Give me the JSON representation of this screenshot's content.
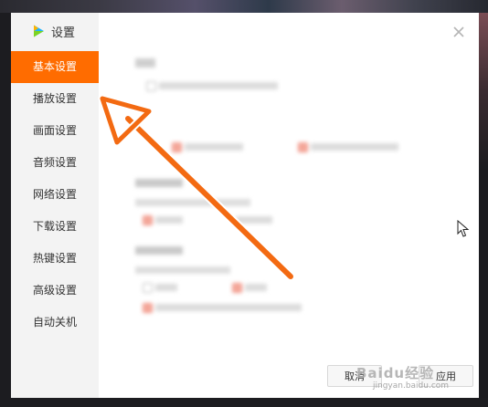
{
  "app": {
    "title": "设置",
    "accent_color": "#ff6c00"
  },
  "sidebar": {
    "items": [
      {
        "label": "基本设置",
        "active": true
      },
      {
        "label": "播放设置",
        "active": false
      },
      {
        "label": "画面设置",
        "active": false
      },
      {
        "label": "音频设置",
        "active": false
      },
      {
        "label": "网络设置",
        "active": false
      },
      {
        "label": "下载设置",
        "active": false
      },
      {
        "label": "热键设置",
        "active": false
      },
      {
        "label": "高级设置",
        "active": false
      },
      {
        "label": "自动关机",
        "active": false
      }
    ]
  },
  "footer": {
    "cancel_label": "取消",
    "apply_label": "应用"
  },
  "watermark": {
    "text": "Baidu经验",
    "url": "jingyan.baidu.com"
  },
  "icons": {
    "close": "close-icon",
    "logo": "video-app-logo-icon",
    "cursor": "mouse-pointer-icon",
    "annotation": "orange-arrow-annotation"
  }
}
